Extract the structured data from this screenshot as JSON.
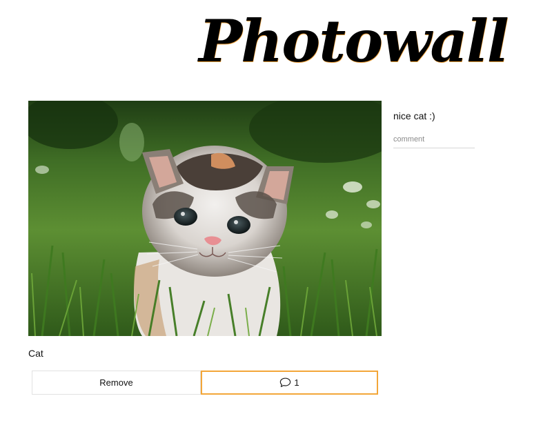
{
  "app": {
    "logo_text": "Photowall"
  },
  "post": {
    "image_subject": "kitten in grass",
    "caption": "Cat",
    "remove_label": "Remove",
    "comment_count": "1"
  },
  "comments": {
    "items": [
      "nice cat :)"
    ],
    "input_placeholder": "comment"
  },
  "colors": {
    "accent_orange": "#f3a638",
    "border_gray": "#e1e1e1"
  }
}
